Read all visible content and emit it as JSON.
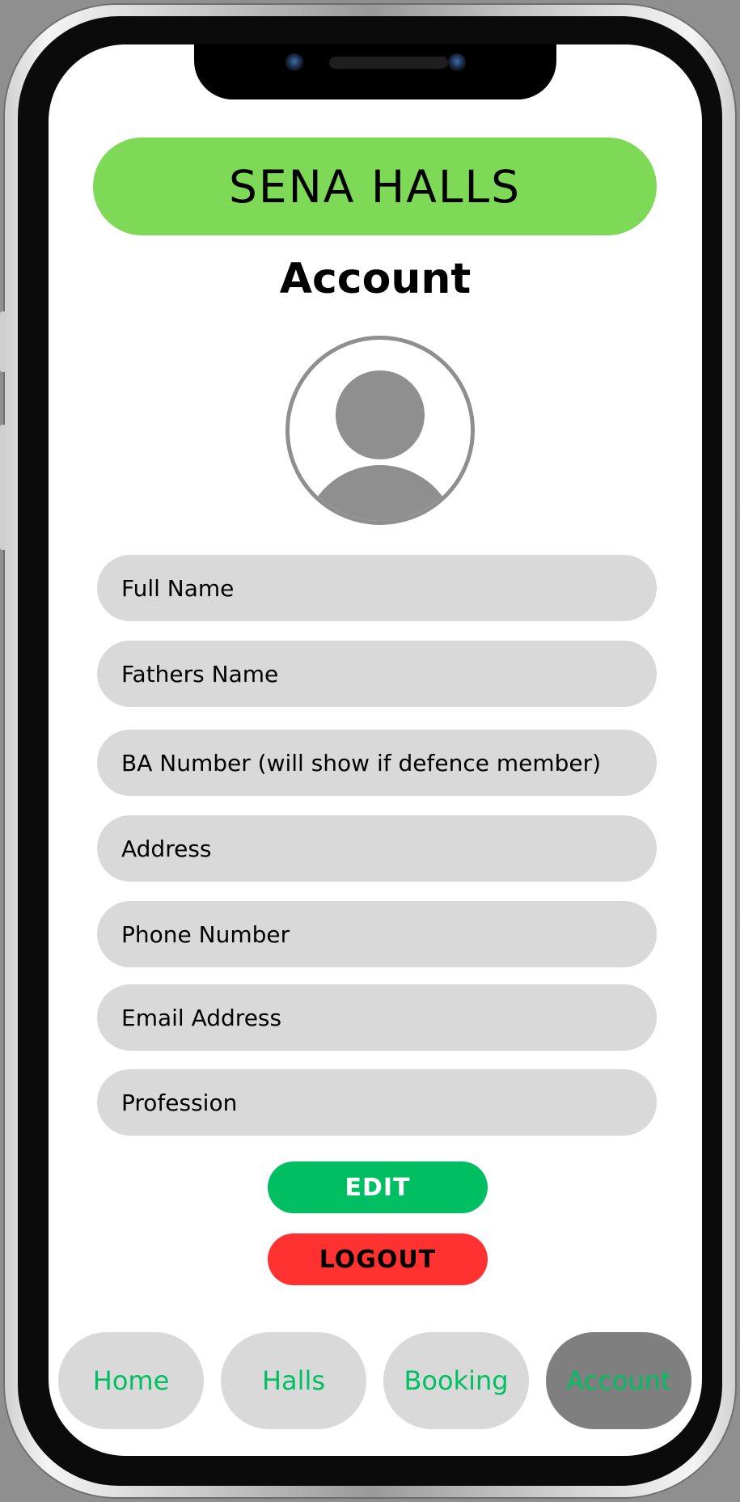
{
  "app": {
    "brand": "SENA HALLS"
  },
  "page": {
    "title": "Account"
  },
  "avatar": {
    "icon": "user-avatar-icon"
  },
  "form": {
    "fields": [
      {
        "label": "Full Name"
      },
      {
        "label": "Fathers Name"
      },
      {
        "label": "BA Number (will show if defence member)"
      },
      {
        "label": "Address"
      },
      {
        "label": "Phone Number"
      },
      {
        "label": "Email Address"
      },
      {
        "label": "Profession"
      }
    ]
  },
  "actions": {
    "edit_label": "EDIT",
    "logout_label": "LOGOUT"
  },
  "nav": {
    "items": [
      {
        "label": "Home"
      },
      {
        "label": "Halls"
      },
      {
        "label": "Booking"
      },
      {
        "label": "Account"
      }
    ],
    "active": "Account"
  },
  "colors": {
    "brand_green": "#7ed957",
    "accent_green": "#00bf63",
    "danger_red": "#ff3131",
    "field_gray": "#d9d9d9",
    "active_nav_gray": "#7f7f7f"
  }
}
